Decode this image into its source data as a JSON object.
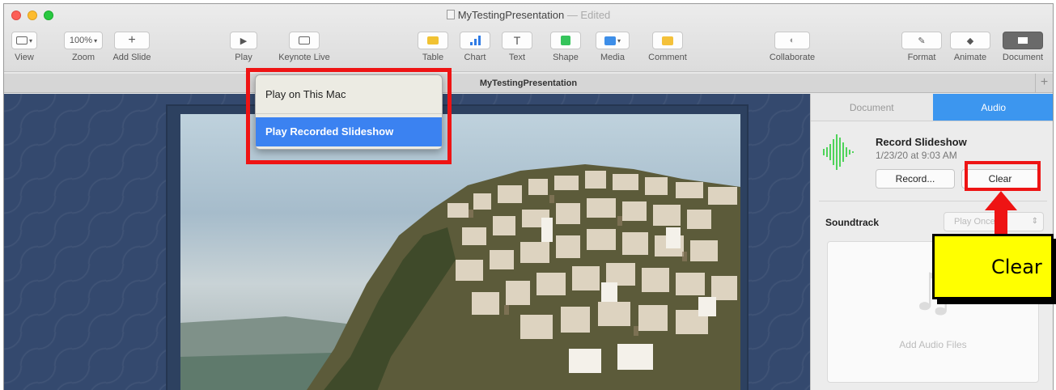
{
  "window": {
    "title": "MyTestingPresentation",
    "title_suffix": " — Edited",
    "tab_title": "MyTestingPresentation"
  },
  "toolbar": {
    "view_label": "View",
    "zoom_value": "100%",
    "zoom_label": "Zoom",
    "add_slide_label": "Add Slide",
    "play_label": "Play",
    "keynote_live_label": "Keynote Live",
    "table_label": "Table",
    "chart_label": "Chart",
    "text_label": "Text",
    "shape_label": "Shape",
    "media_label": "Media",
    "comment_label": "Comment",
    "collaborate_label": "Collaborate",
    "format_label": "Format",
    "animate_label": "Animate",
    "document_label": "Document"
  },
  "play_menu": {
    "items": [
      {
        "label": "Play on This Mac"
      },
      {
        "label": "Play Recorded Slideshow"
      }
    ]
  },
  "inspector": {
    "tabs": [
      {
        "label": "Document"
      },
      {
        "label": "Audio"
      }
    ],
    "recording": {
      "title": "Record Slideshow",
      "date": "1/23/20 at 9:03 AM",
      "record_label": "Record...",
      "clear_label": "Clear"
    },
    "soundtrack": {
      "label": "Soundtrack",
      "mode": "Play Once",
      "drop_text": "Add Audio Files"
    }
  },
  "annotation": {
    "callout_text": "Clear",
    "highlight_color": "#ee1414",
    "callout_color": "#ffff00"
  },
  "colors": {
    "accent": "#3c96ef",
    "menu_highlight": "#3b82f1",
    "waveform": "#4fd35a"
  }
}
